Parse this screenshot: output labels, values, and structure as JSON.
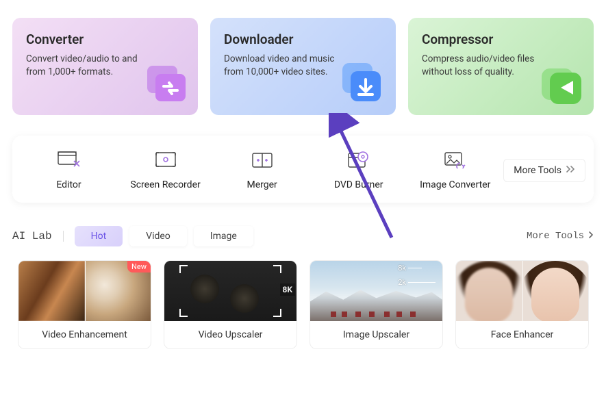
{
  "cards": {
    "converter": {
      "title": "Converter",
      "desc": "Convert video/audio to and from 1,000+ formats."
    },
    "downloader": {
      "title": "Downloader",
      "desc": "Download video and music from 10,000+ video sites."
    },
    "compressor": {
      "title": "Compressor",
      "desc": "Compress audio/video files without loss of quality."
    }
  },
  "tools": {
    "editor": "Editor",
    "screen_recorder": "Screen Recorder",
    "merger": "Merger",
    "dvd_burner": "DVD Burner",
    "image_converter": "Image Converter",
    "more": "More Tools"
  },
  "ailab": {
    "label": "AI Lab",
    "tabs": {
      "hot": "Hot",
      "video": "Video",
      "image": "Image"
    },
    "more": "More Tools",
    "items": {
      "enhancement": {
        "badge": "New",
        "title": "Video Enhancement"
      },
      "upscaler": {
        "title": "Video Upscaler",
        "badge8k": "8K"
      },
      "img_upscaler": {
        "title": "Image Upscaler",
        "l8": "8k",
        "l2": "2k"
      },
      "face": {
        "title": "Face Enhancer"
      }
    }
  }
}
